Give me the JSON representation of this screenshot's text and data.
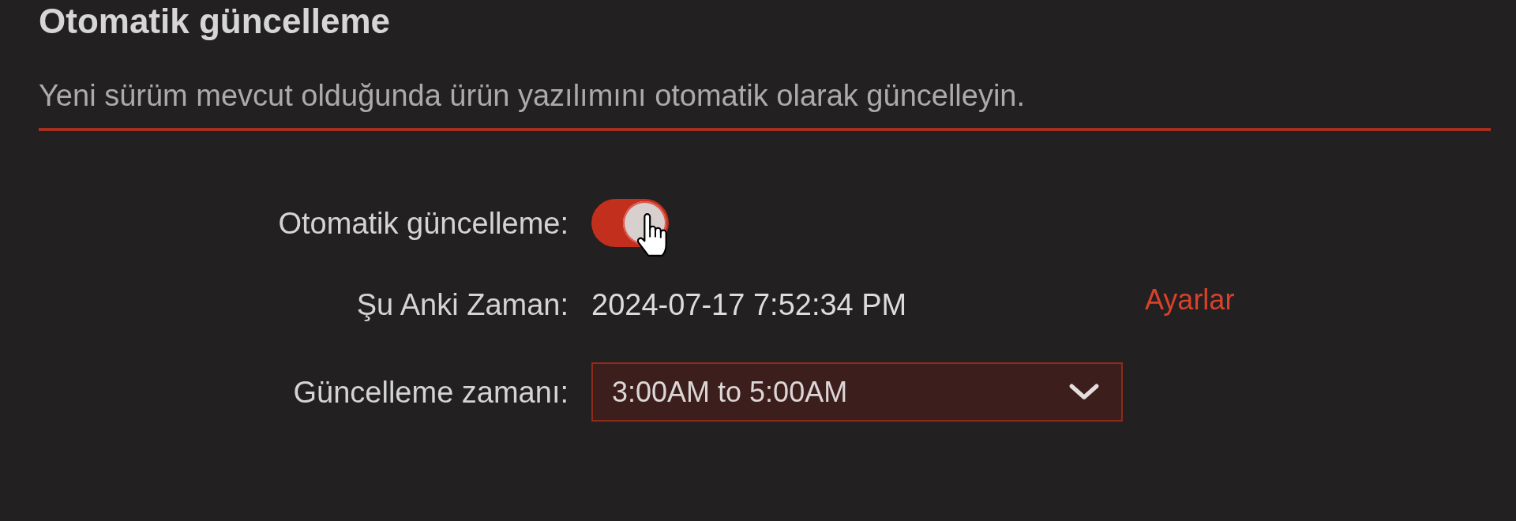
{
  "section": {
    "title": "Otomatik güncelleme",
    "description": "Yeni sürüm mevcut olduğunda ürün yazılımını otomatik olarak güncelleyin."
  },
  "settings": [
    {
      "kind": "toggle",
      "label": "Otomatik güncelleme:",
      "on": true
    },
    {
      "kind": "text",
      "label": "Şu Anki Zaman:",
      "value": "2024-07-17 7:52:34 PM",
      "link": "Ayarlar"
    },
    {
      "kind": "select",
      "label": "Güncelleme zamanı:",
      "value": "3:00AM to 5:00AM"
    }
  ]
}
